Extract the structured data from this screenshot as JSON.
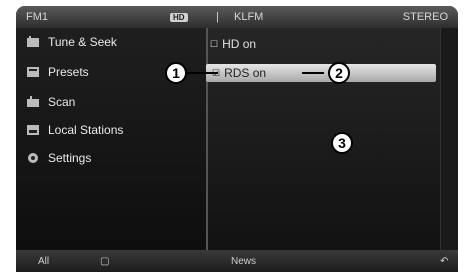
{
  "status": {
    "band": "FM1",
    "tag": "HD",
    "separator": "|",
    "station": "KLFM",
    "mode": "STEREO"
  },
  "menu": {
    "items": [
      {
        "label": "Tune & Seek",
        "icon": "tune-icon"
      },
      {
        "label": "Presets",
        "icon": "presets-icon"
      },
      {
        "label": "Scan",
        "icon": "scan-icon"
      },
      {
        "label": "Local Stations",
        "icon": "local-stations-icon"
      },
      {
        "label": "Settings",
        "icon": "gear-icon"
      }
    ]
  },
  "options": {
    "items": [
      {
        "label": "HD on",
        "checked": false,
        "selected": false
      },
      {
        "label": "RDS on",
        "checked": true,
        "selected": true
      }
    ]
  },
  "callouts": [
    "1",
    "2",
    "3"
  ],
  "bottom": {
    "left": "All",
    "center": "News"
  }
}
